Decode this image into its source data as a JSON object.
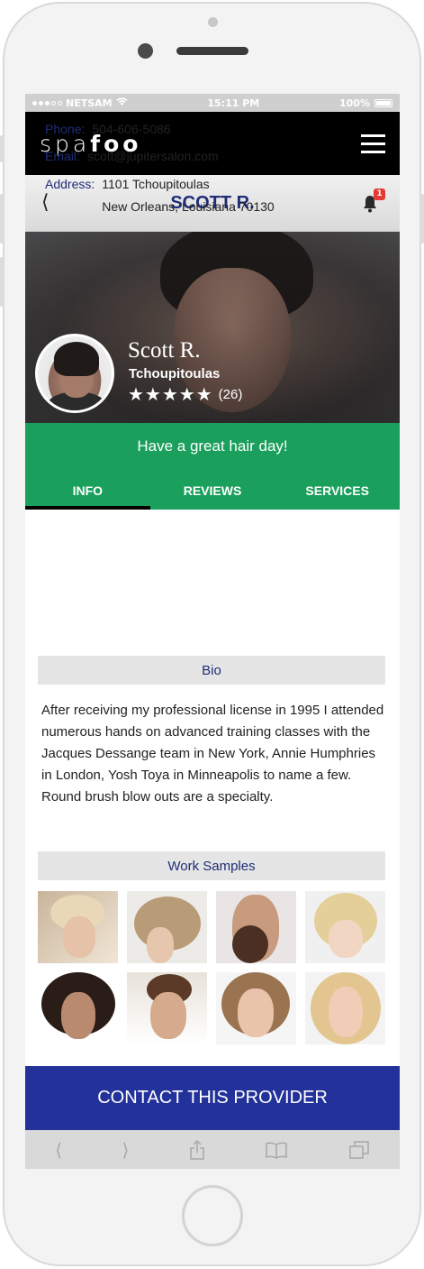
{
  "status_bar": {
    "carrier": "NETSAM",
    "time": "15:11 PM",
    "battery": "100%"
  },
  "app": {
    "logo_light": "spa",
    "logo_bold": "foo"
  },
  "header": {
    "title": "SCOTT R.",
    "notification_count": "1"
  },
  "profile": {
    "name": "Scott R.",
    "location": "Tchoupitoulas",
    "stars": "★★★★★",
    "review_count": "(26)"
  },
  "tagline": "Have a great hair day!",
  "tabs": [
    {
      "label": "INFO",
      "active": true
    },
    {
      "label": "REVIEWS",
      "active": false
    },
    {
      "label": "SERVICES",
      "active": false
    }
  ],
  "contact": {
    "phone_label": "Phone:",
    "phone": "504-606-5086",
    "email_label": "Email:",
    "email": "scott@jupitersalon.com",
    "address_label": "Address:",
    "address_line1": "1101 Tchoupitoulas",
    "address_line2": "New Orleans, Louisiana  70130"
  },
  "bio": {
    "heading": "Bio",
    "text": "After receiving my professional license in 1995 I attended numerous hands on advanced training classes with the Jacques Dessange  team in New York, Annie Humphries in London, Yosh Toya in Minneapolis to name a few. Round brush blow outs are a specialty."
  },
  "work_samples": {
    "heading": "Work Samples",
    "count": 8
  },
  "cta": "CONTACT THIS PROVIDER",
  "colors": {
    "brand_green": "#1a9f5c",
    "brand_blue": "#23319a",
    "title_navy": "#1f2d77",
    "badge_red": "#e53935"
  }
}
